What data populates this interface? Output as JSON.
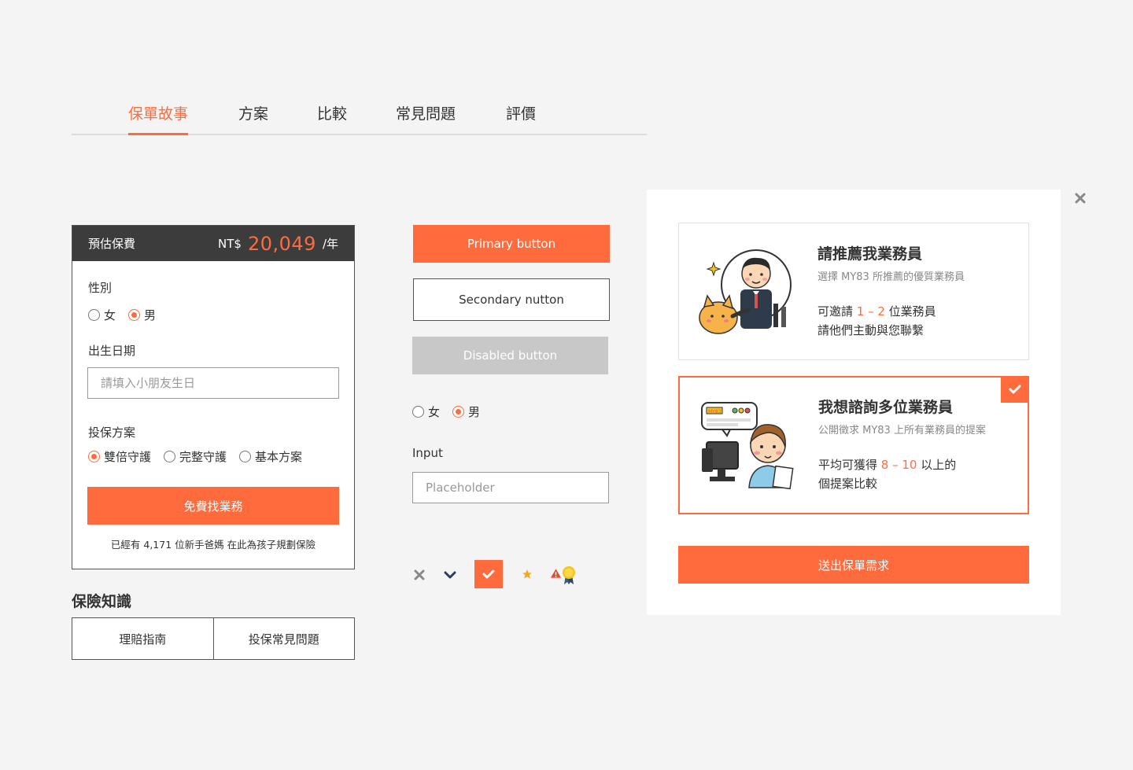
{
  "tabs": [
    {
      "label": "保單故事",
      "active": true
    },
    {
      "label": "方案"
    },
    {
      "label": "比較"
    },
    {
      "label": "常見問題"
    },
    {
      "label": "評價"
    }
  ],
  "estimate": {
    "header_label": "預估保費",
    "currency": "NT$",
    "price": "20,049",
    "per": "/年",
    "gender_label": "性別",
    "gender_options": [
      "女",
      "男"
    ],
    "gender_selected": "男",
    "birthday_label": "出生日期",
    "birthday_placeholder": "請填入小朋友生日",
    "plan_label": "投保方案",
    "plan_options": [
      "雙倍守護",
      "完整守護",
      "基本方案"
    ],
    "plan_selected": "雙倍守護",
    "cta": "免費找業務",
    "note": "已經有 4,171 位新手爸媽 在此為孩子規劃保險"
  },
  "knowledge": {
    "title": "保險知識",
    "links": [
      "理賠指南",
      "投保常見問題"
    ]
  },
  "components": {
    "primary_button": "Primary button",
    "secondary_button": "Secondary nutton",
    "disabled_button": "Disabled button",
    "radio_options": [
      "女",
      "男"
    ],
    "radio_selected": "男",
    "input_label": "Input",
    "input_placeholder": "Placeholder",
    "icons": [
      "close-icon",
      "chevron-down-icon",
      "check-icon",
      "star-icon",
      "warning-icon",
      "award-badge-icon"
    ]
  },
  "modal": {
    "option1": {
      "title": "請推薦我業務員",
      "subtitle": "選擇 MY83 所推薦的優質業務員",
      "line1_pre": "可邀請 ",
      "line1_hl": "1 – 2",
      "line1_post": " 位業務員",
      "line2": "請他們主動與您聯繫",
      "selected": false
    },
    "option2": {
      "title": "我想諮詢多位業務員",
      "subtitle": "公開徵求 MY83 上所有業務員的提案",
      "line1_pre": "平均可獲得 ",
      "line1_hl": "8 – 10",
      "line1_post": " 以上的",
      "line2": "個提案比較",
      "screen_text": "MY83",
      "selected": true
    },
    "submit": "送出保單需求"
  },
  "colors": {
    "accent": "#ff6b3d",
    "dark_header": "#3c3c3c",
    "disabled": "#c8c8c8",
    "background": "#f4f4f4"
  }
}
